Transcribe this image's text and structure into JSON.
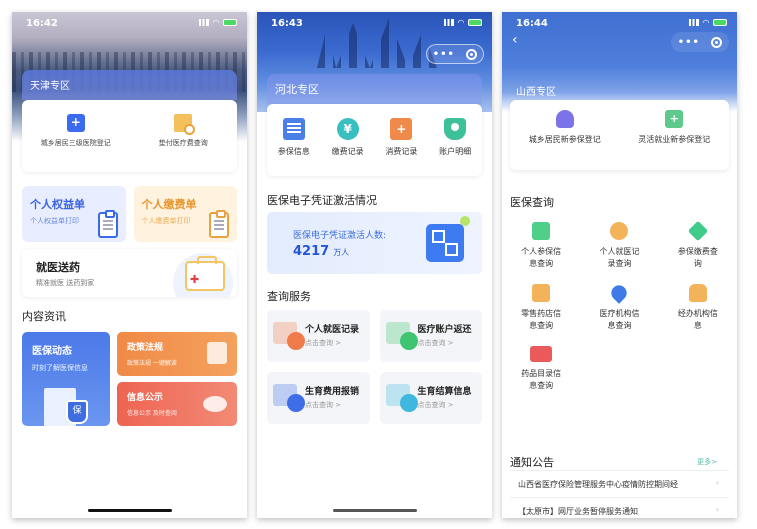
{
  "phones": [
    {
      "status": {
        "time": "16:42"
      },
      "zone_title": "天津专区",
      "quick_items": [
        {
          "icon": "edit-register-icon",
          "label": "城乡居民三级医院登记"
        },
        {
          "icon": "fee-search-icon",
          "label": "垫付医疗费查询"
        }
      ],
      "cards": [
        {
          "title": "个人权益单",
          "subtitle": "个人权益单打印",
          "icon": "clipboard-crown-icon"
        },
        {
          "title": "个人缴费单",
          "subtitle": "个人缴费单打印",
          "icon": "clipboard-shield-icon"
        }
      ],
      "delivery": {
        "title": "就医送药",
        "subtitle": "精准就医 送药到家",
        "icon": "medical-kit-icon"
      },
      "news_section": "内容资讯",
      "news": [
        {
          "title": "医保动态",
          "subtitle": "时刻了解医保信息",
          "icon": "hospital-shield-icon"
        },
        {
          "title": "政策法规",
          "subtitle": "政策法规 一键解读",
          "icon": "document-icon"
        },
        {
          "title": "信息公示",
          "subtitle": "信息公示 及时查阅",
          "icon": "chat-bubble-icon"
        }
      ]
    },
    {
      "status": {
        "time": "16:43"
      },
      "zone_title": "河北专区",
      "grid": [
        {
          "icon": "insurance-card-icon",
          "label": "参保信息"
        },
        {
          "icon": "yen-coin-icon",
          "label": "缴费记录"
        },
        {
          "icon": "medical-kit-icon",
          "label": "消费记录"
        },
        {
          "icon": "account-shield-icon",
          "label": "账户明细"
        }
      ],
      "activation_section": "医保电子凭证激活情况",
      "activation": {
        "label": "医保电子凭证激活人数:",
        "value": "4217",
        "unit": "万人"
      },
      "services_section": "查询服务",
      "services": [
        {
          "title": "个人就医记录",
          "link": "点击查询 >",
          "color": "#f07b4a"
        },
        {
          "title": "医疗账户返还",
          "link": "点击查询 >",
          "color": "#3fc472"
        },
        {
          "title": "生育费用报销",
          "link": "点击查询 >",
          "color": "#3e6de8"
        },
        {
          "title": "生育结算信息",
          "link": "点击查询 >",
          "color": "#3fb7de"
        }
      ]
    },
    {
      "status": {
        "time": "16:44"
      },
      "zone_title": "山西专区",
      "grid": [
        {
          "icon": "person-icon",
          "label": "城乡居民新参保登记"
        },
        {
          "icon": "briefcase-plus-icon",
          "label": "灵活就业新参保登记"
        }
      ],
      "query_section": "医保查询",
      "queries": [
        {
          "icon": "clipboard-icon",
          "label": "个人参保信息查询",
          "color": "#4fcf87"
        },
        {
          "icon": "search-icon",
          "label": "个人就医记录查询",
          "color": "#f3b35a"
        },
        {
          "icon": "layers-icon",
          "label": "参保缴费查询",
          "color": "#3fcc8a"
        },
        {
          "icon": "pharmacy-box-icon",
          "label": "零售药店信息查询",
          "color": "#f3b35a"
        },
        {
          "icon": "location-pin-icon",
          "label": "医疗机构信息查询",
          "color": "#3e7be8"
        },
        {
          "icon": "bag-icon",
          "label": "经办机构信息",
          "color": "#f3b35a"
        },
        {
          "icon": "drug-catalog-icon",
          "label": "药品目录信息查询",
          "color": "#ea5a5a"
        }
      ],
      "notice_section": "通知公告",
      "more_label": "更多>",
      "notices": [
        "山西省医疗保险管理服务中心疫情防控期间经",
        "【太原市】网厅业务暂停服务通知"
      ]
    }
  ]
}
